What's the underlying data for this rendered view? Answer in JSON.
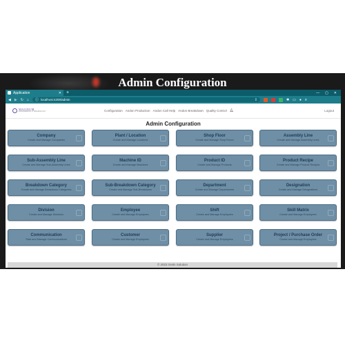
{
  "video_title": "Admin Configuration",
  "browser": {
    "tab_title": "Application",
    "tab_close": "✕",
    "new_tab": "+",
    "url": "localhost:4200/admin",
    "window_controls": [
      "—",
      "▢",
      "✕"
    ],
    "nav_icons": [
      "arrow-left-icon",
      "arrow-right-icon",
      "reload-icon",
      "home-icon"
    ]
  },
  "app": {
    "logo_name": "MAGNUM",
    "logo_tagline": "ENGINEERING & TECHNOLOGY",
    "nav": {
      "configuration": "Configuration",
      "andon_production": "Andon Production",
      "andon_call_help": "Andon Call Help",
      "andon_breakdown": "Andon Breakdown",
      "quality_control": "Quality Control"
    },
    "logout": "Logout",
    "page_title": "Admin Configuration",
    "cards": [
      {
        "title": "Company",
        "subtitle": "Create and Manage Companies"
      },
      {
        "title": "Plant / Location",
        "subtitle": "Create and Manage Locations"
      },
      {
        "title": "Shop Floor",
        "subtitle": "Create and Manage Shop Floors"
      },
      {
        "title": "Assembly Line",
        "subtitle": "Create and Manage Assembly Lines"
      },
      {
        "title": "Sub-Assembly Line",
        "subtitle": "Create and Manage Sub-Assembly Lines"
      },
      {
        "title": "Machine ID",
        "subtitle": "Create and Manage Machines"
      },
      {
        "title": "Product ID",
        "subtitle": "Create and Manage Products"
      },
      {
        "title": "Product Recipe",
        "subtitle": "Create and Manage Product Recipes"
      },
      {
        "title": "Breakdown Category",
        "subtitle": "Create and Manage Breakdown Categories"
      },
      {
        "title": "Sub-Breakdown Category",
        "subtitle": "Create and Manage Sub-Breakdown"
      },
      {
        "title": "Department",
        "subtitle": "Create and Manage Departments"
      },
      {
        "title": "Designation",
        "subtitle": "Create and Manage Designations"
      },
      {
        "title": "Division",
        "subtitle": "Create and Manage Divisions"
      },
      {
        "title": "Employee",
        "subtitle": "Create and Manage Employees"
      },
      {
        "title": "Shift",
        "subtitle": "Create and Manage Employees"
      },
      {
        "title": "Skill Matrix",
        "subtitle": "Create and Manage Employees"
      },
      {
        "title": "Communication",
        "subtitle": "Start and Manage Communications"
      },
      {
        "title": "Customer",
        "subtitle": "Create and Manage Employees"
      },
      {
        "title": "Supplier",
        "subtitle": "Create and Manage Employees"
      },
      {
        "title": "Project / Purchase Order",
        "subtitle": "Create and Manage Employees"
      }
    ],
    "footer": "© 2023 Getin Solution"
  },
  "colors": {
    "browser_chrome": "#1d7d8b",
    "card_fill": "#6e8fa6",
    "card_title": "#1e3a55"
  }
}
